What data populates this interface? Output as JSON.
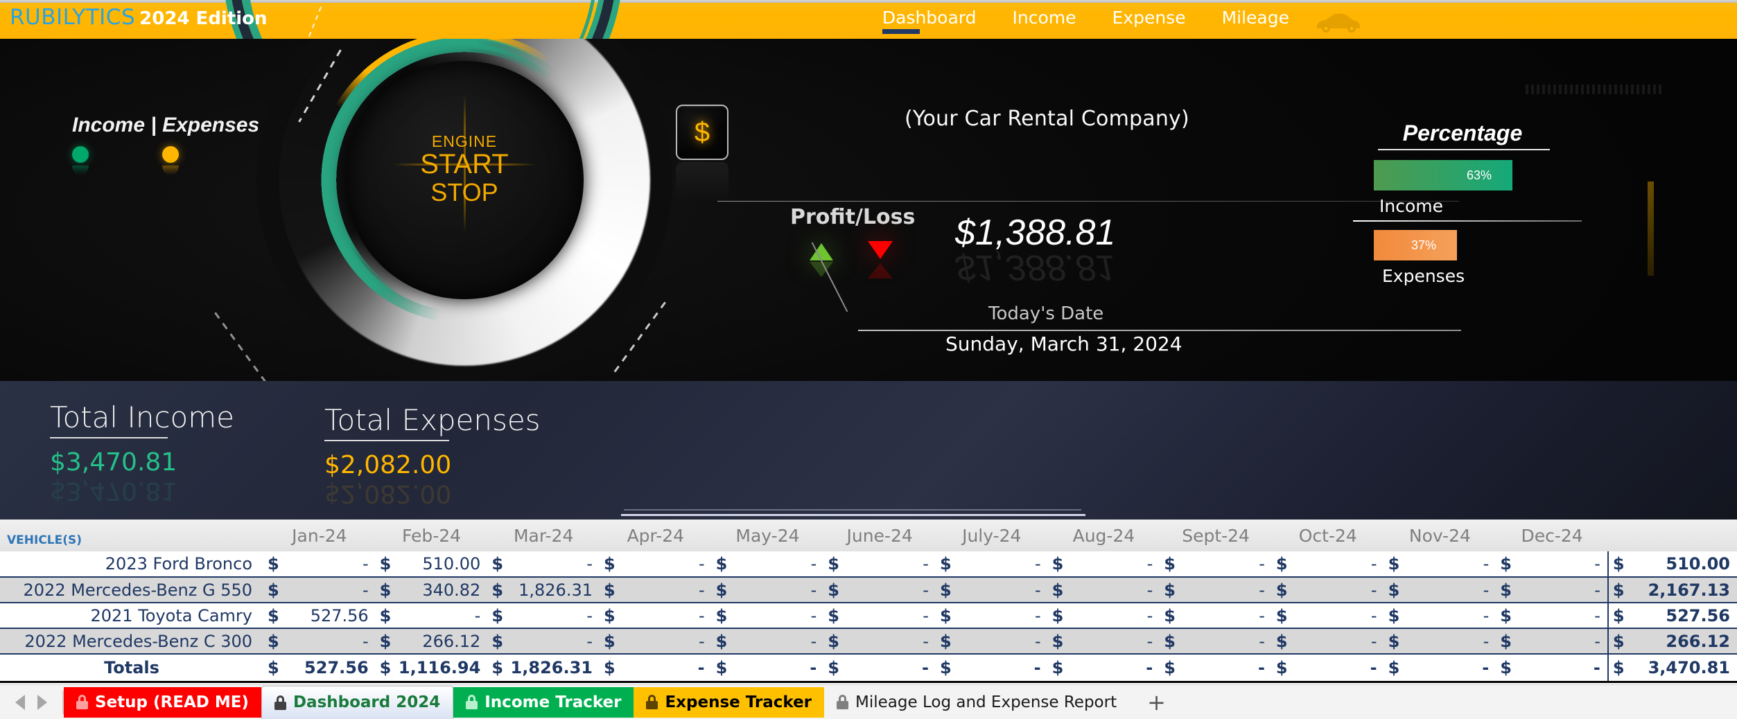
{
  "header": {
    "brand_primary": "RUBILYTICS",
    "brand_secondary": "2024 Edition",
    "nav": [
      {
        "label": "Dashboard",
        "active": true
      },
      {
        "label": "Income",
        "active": false
      },
      {
        "label": "Expense",
        "active": false
      },
      {
        "label": "Mileage",
        "active": false
      }
    ],
    "car_icon": "car-icon"
  },
  "hero": {
    "legend_title": "Income | Expenses",
    "legend_income_color": "#00a86b",
    "legend_expense_color": "#ffb600",
    "engine_line1": "ENGINE",
    "engine_line2": "START",
    "engine_line3": "STOP",
    "dollar_key": "$",
    "company_name": "(Your Car Rental Company)",
    "profit_loss_label": "Profit/Loss",
    "profit_loss_amount": "$1,388.81",
    "arrow_up_color": "#6ec331",
    "arrow_down_color": "#ff0000",
    "today_label": "Today's Date",
    "today_date": "Sunday, March 31, 2024",
    "percentage": {
      "title": "Percentage",
      "income_value": "63%",
      "income_label": "Income",
      "income_color": "#15a97a",
      "expenses_value": "37%",
      "expenses_label": "Expenses",
      "expenses_color": "#f18a3c"
    }
  },
  "totals_strip": {
    "income_label": "Total Income",
    "income_value": "$3,470.81",
    "income_color": "#24c18a",
    "expenses_label": "Total Expenses",
    "expenses_value": "$2,082.00",
    "expenses_color": "#ffb600"
  },
  "table": {
    "vehicle_header": "VEHICLE(S)",
    "months": [
      "Jan-24",
      "Feb-24",
      "Mar-24",
      "Apr-24",
      "May-24",
      "June-24",
      "July-24",
      "Aug-24",
      "Sept-24",
      "Oct-24",
      "Nov-24",
      "Dec-24"
    ],
    "total_header": "",
    "currency_symbol": "$",
    "rows": [
      {
        "name": "2023 Ford Bronco",
        "values": [
          "-",
          "510.00",
          "-",
          "-",
          "-",
          "-",
          "-",
          "-",
          "-",
          "-",
          "-",
          "-"
        ],
        "total": "510.00"
      },
      {
        "name": "2022 Mercedes-Benz G 550",
        "values": [
          "-",
          "340.82",
          "1,826.31",
          "-",
          "-",
          "-",
          "-",
          "-",
          "-",
          "-",
          "-",
          "-"
        ],
        "total": "2,167.13"
      },
      {
        "name": "2021 Toyota Camry",
        "values": [
          "527.56",
          "-",
          "-",
          "-",
          "-",
          "-",
          "-",
          "-",
          "-",
          "-",
          "-",
          "-"
        ],
        "total": "527.56"
      },
      {
        "name": "2022 Mercedes-Benz C 300",
        "values": [
          "-",
          "266.12",
          "-",
          "-",
          "-",
          "-",
          "-",
          "-",
          "-",
          "-",
          "-",
          "-"
        ],
        "total": "266.12"
      }
    ],
    "totals_row": {
      "name": "Totals",
      "values": [
        "527.56",
        "1,116.94",
        "1,826.31",
        "-",
        "-",
        "-",
        "-",
        "-",
        "-",
        "-",
        "-",
        "-"
      ],
      "total": "3,470.81"
    }
  },
  "sheet_tabs": {
    "prev_label": "◀",
    "next_label": "▶",
    "add_label": "+",
    "tabs": [
      {
        "label": "Setup (READ ME)",
        "locked": true,
        "active": false
      },
      {
        "label": "Dashboard 2024",
        "locked": true,
        "active": true
      },
      {
        "label": "Income Tracker",
        "locked": true,
        "active": false
      },
      {
        "label": "Expense Tracker",
        "locked": true,
        "active": false
      },
      {
        "label": "Mileage Log and Expense Report",
        "locked": true,
        "active": false
      }
    ]
  }
}
